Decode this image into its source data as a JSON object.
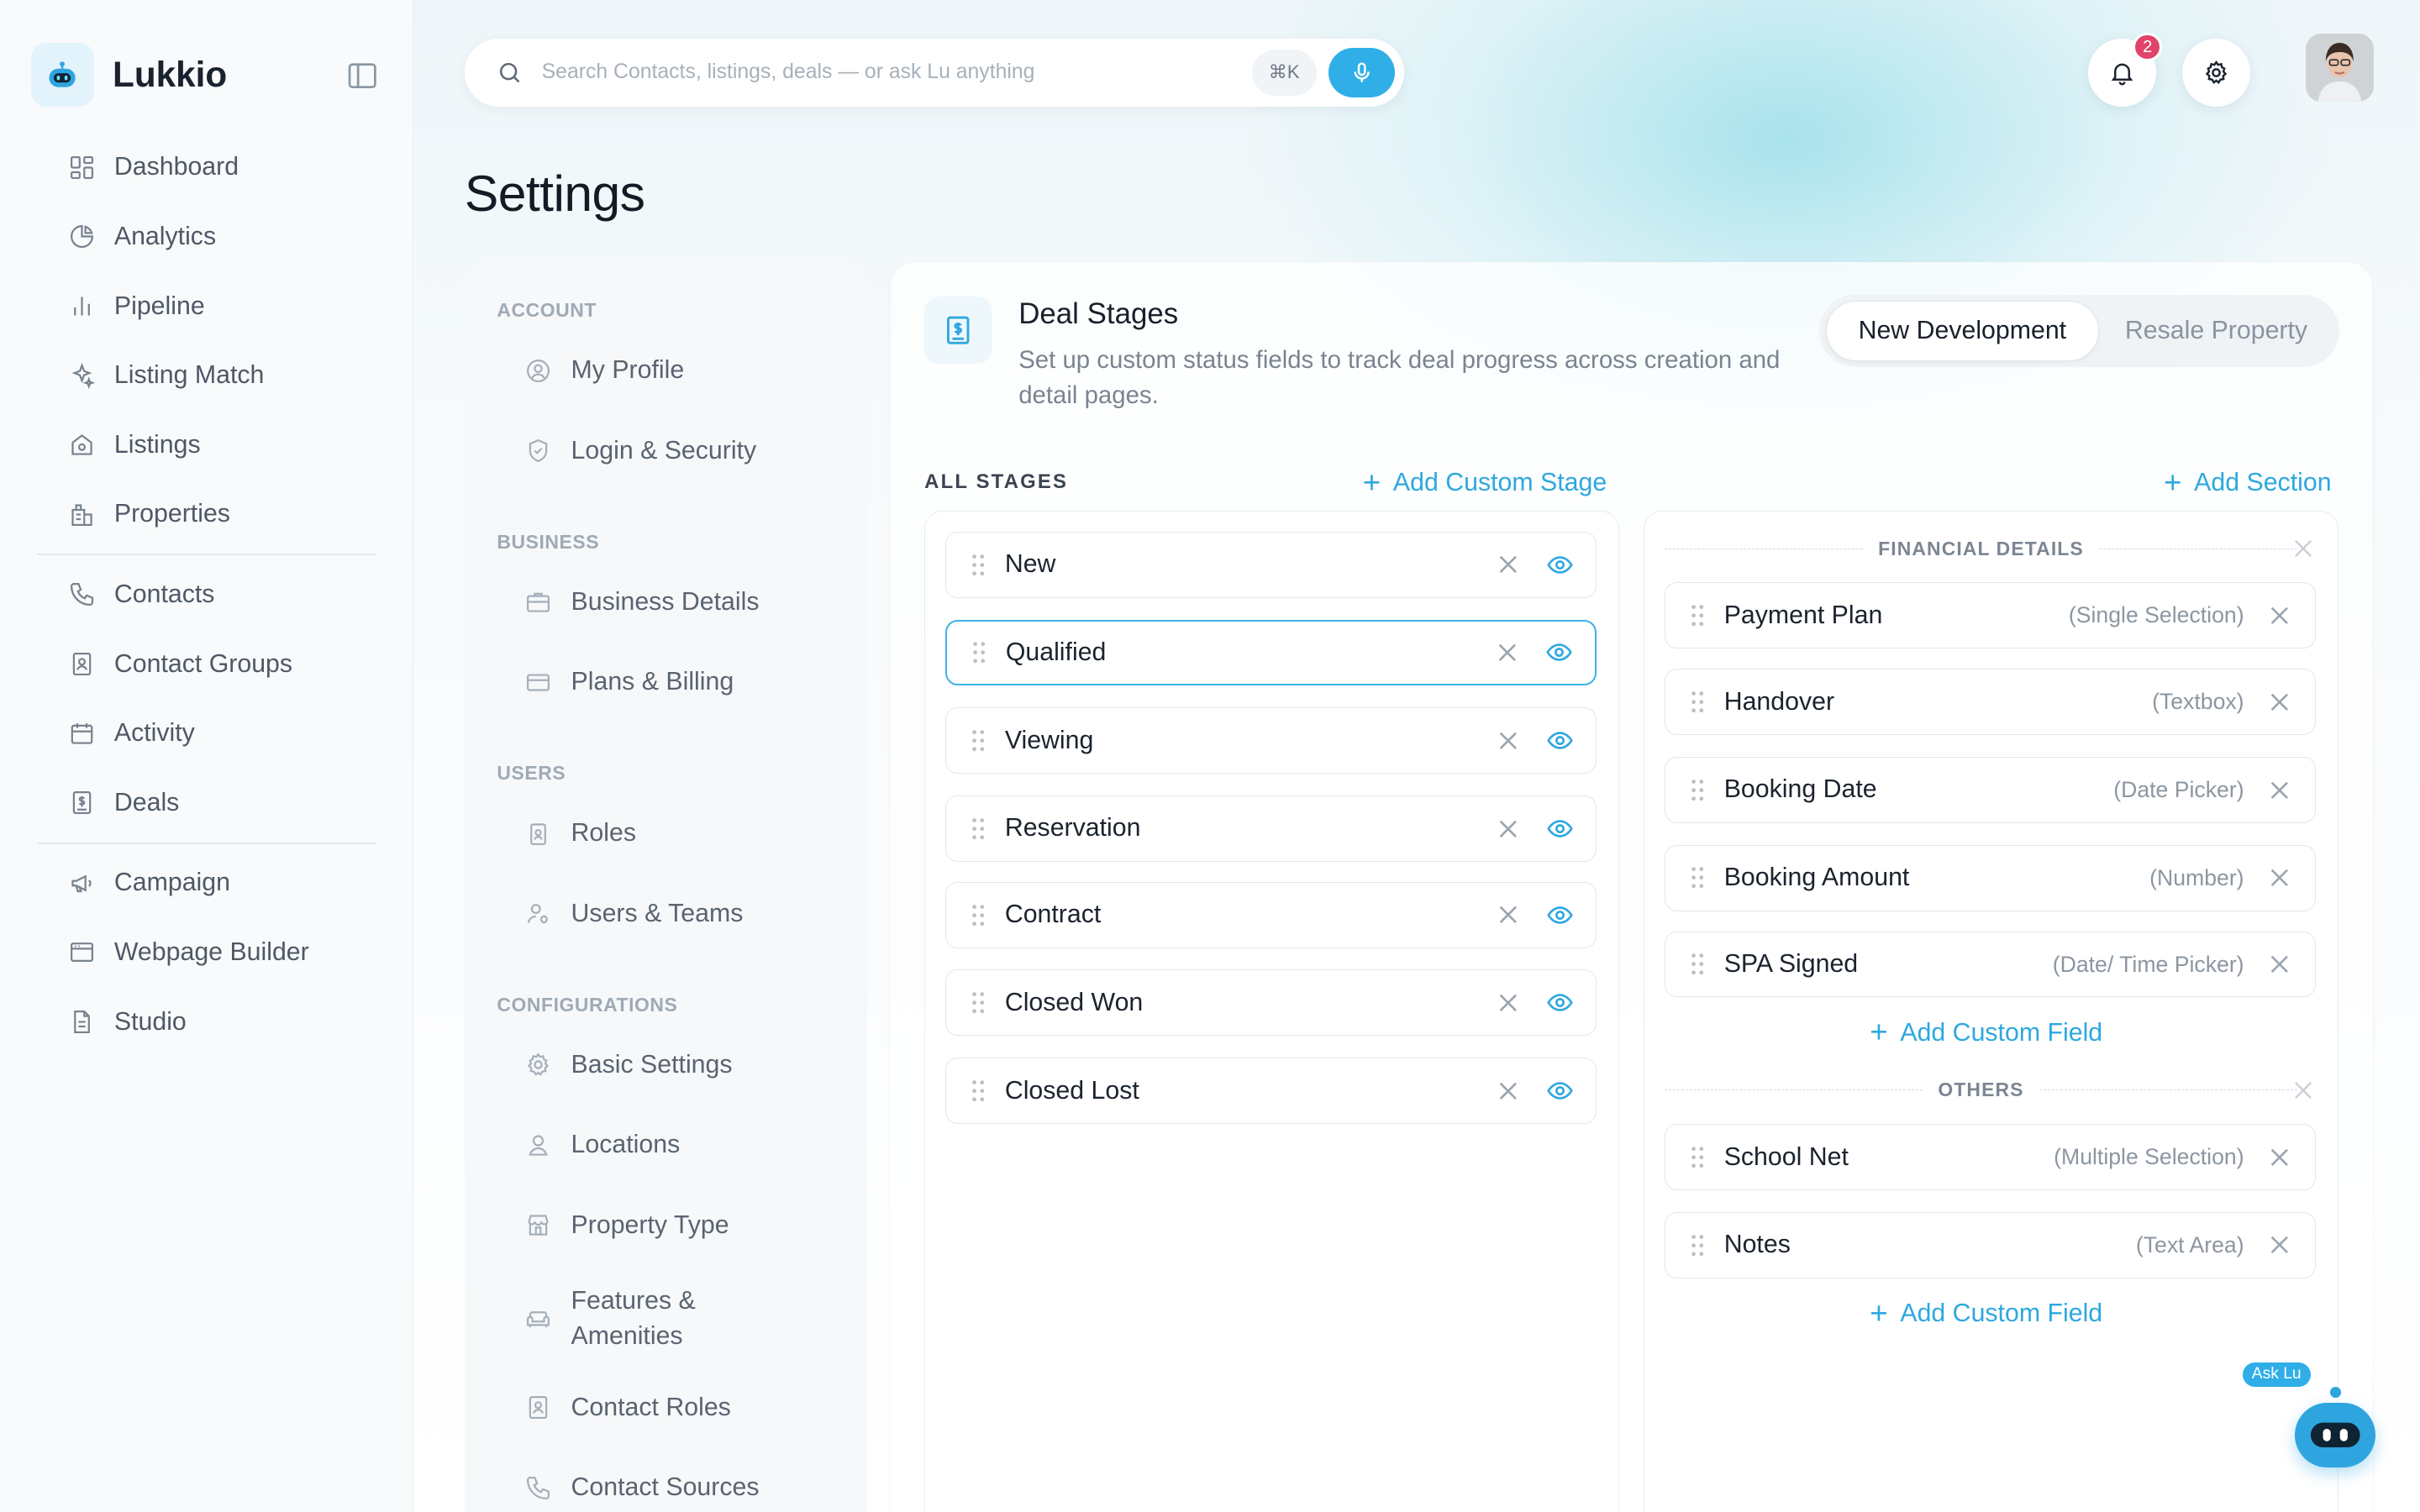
{
  "app": {
    "name": "Lukkio"
  },
  "nav": {
    "group1": [
      {
        "label": "Dashboard",
        "icon": "dashboard-icon"
      },
      {
        "label": "Analytics",
        "icon": "pie-chart-icon"
      },
      {
        "label": "Pipeline",
        "icon": "bar-chart-icon"
      },
      {
        "label": "Listing Match",
        "icon": "sparkle-icon"
      },
      {
        "label": "Listings",
        "icon": "house-icon"
      },
      {
        "label": "Properties",
        "icon": "building-icon"
      }
    ],
    "group2": [
      {
        "label": "Contacts",
        "icon": "phone-icon"
      },
      {
        "label": "Contact Groups",
        "icon": "contact-card-icon"
      },
      {
        "label": "Activity",
        "icon": "calendar-icon"
      },
      {
        "label": "Deals",
        "icon": "dollar-doc-icon"
      }
    ],
    "group3": [
      {
        "label": "Campaign",
        "icon": "megaphone-icon"
      },
      {
        "label": "Webpage Builder",
        "icon": "browser-icon"
      },
      {
        "label": "Studio",
        "icon": "file-icon"
      }
    ]
  },
  "topbar": {
    "search_placeholder": "Search Contacts, listings, deals — or ask Lu anything",
    "shortcut": "⌘K",
    "notification_count": "2"
  },
  "page": {
    "title": "Settings"
  },
  "settings_nav": {
    "account": {
      "label": "ACCOUNT",
      "items": [
        "My Profile",
        "Login & Security"
      ]
    },
    "business": {
      "label": "BUSINESS",
      "items": [
        "Business Details",
        "Plans & Billing"
      ]
    },
    "users": {
      "label": "USERS",
      "items": [
        "Roles",
        "Users & Teams"
      ]
    },
    "configurations": {
      "label": "CONFIGURATIONS",
      "items": [
        "Basic Settings",
        "Locations",
        "Property Type",
        "Features & Amenities",
        "Contact Roles",
        "Contact Sources"
      ]
    }
  },
  "deal_stages": {
    "title": "Deal Stages",
    "description": "Set up custom status fields to track deal progress across creation and detail pages.",
    "tabs": [
      "New Development",
      "Resale Property"
    ],
    "active_tab": "New Development",
    "all_stages_label": "ALL STAGES",
    "add_custom_stage": "Add Custom Stage",
    "add_section": "Add Section",
    "stages": [
      "New",
      "Qualified",
      "Viewing",
      "Reservation",
      "Contract",
      "Closed Won",
      "Closed Lost"
    ],
    "selected_stage": "Qualified",
    "sections": [
      {
        "title": "FINANCIAL DETAILS",
        "fields": [
          {
            "label": "Payment Plan",
            "type": "(Single Selection)"
          },
          {
            "label": "Handover",
            "type": "(Textbox)"
          },
          {
            "label": "Booking Date",
            "type": "(Date Picker)"
          },
          {
            "label": "Booking Amount",
            "type": "(Number)"
          },
          {
            "label": "SPA Signed",
            "type": "(Date/ Time Picker)"
          }
        ],
        "add_field": "Add Custom Field"
      },
      {
        "title": "OTHERS",
        "fields": [
          {
            "label": "School Net",
            "type": "(Multiple Selection)"
          },
          {
            "label": "Notes",
            "type": "(Text Area)"
          }
        ],
        "add_field": "Add Custom Field"
      }
    ]
  },
  "assistant": {
    "label": "Ask Lu"
  },
  "colors": {
    "accent": "#2faee8",
    "badge": "#e2436a",
    "text": "#1b232e",
    "muted": "#7a8490"
  }
}
